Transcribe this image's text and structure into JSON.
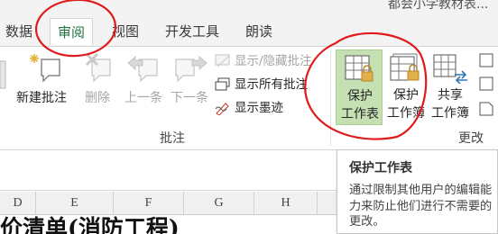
{
  "window": {
    "title_partial": "都会小学教材表..."
  },
  "tabs": [
    {
      "label": "数据",
      "active": false
    },
    {
      "label": "审阅",
      "active": true
    },
    {
      "label": "视图",
      "active": false
    },
    {
      "label": "开发工具",
      "active": false
    },
    {
      "label": "朗读",
      "active": false
    }
  ],
  "ribbon": {
    "comments_group": {
      "label": "批注",
      "new_comment": "新建批注",
      "delete": "删除",
      "previous": "上一条",
      "next": "下一条",
      "show_hide_comment": "显示/隐藏批注",
      "show_all_comments": "显示所有批注",
      "show_ink": "显示墨迹"
    },
    "changes_group": {
      "label": "更改",
      "protect_sheet_line1": "保护",
      "protect_sheet_line2": "工作表",
      "protect_workbook_line1": "保护",
      "protect_workbook_line2": "工作簿",
      "share_workbook_line1": "共享",
      "share_workbook_line2": "工作簿"
    }
  },
  "grid": {
    "columns": [
      "D",
      "E",
      "F",
      "G",
      "H"
    ],
    "cell_text": "价清单(消防工程)"
  },
  "tooltip": {
    "title": "保护工作表",
    "body": "通过限制其他用户的编辑能力来防止他们进行不需要的更改。"
  },
  "colors": {
    "accent_green": "#217346",
    "annotation_red": "#e01b1b",
    "lock_gold": "#e2b04a"
  }
}
